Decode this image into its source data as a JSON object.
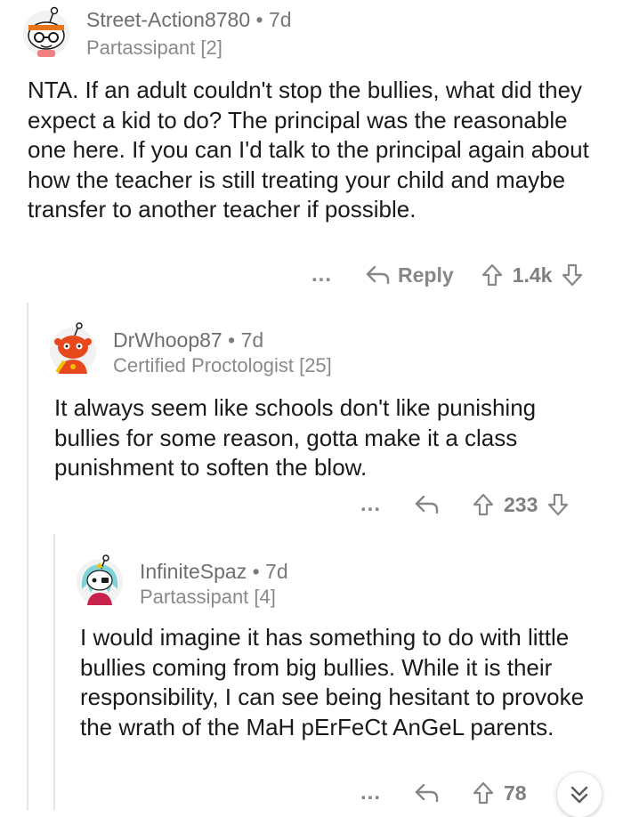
{
  "comments": [
    {
      "username": "Street-Action8780",
      "time": "7d",
      "flair": "Partassipant [2]",
      "body": "NTA. If an adult couldn't stop the bullies, what did they expect a kid to do? The principal was the reasonable one here. If you can I'd talk to the principal again about how the teacher is still treating your child and maybe transfer to another teacher if possible.",
      "more": "...",
      "reply_label": "Reply",
      "score": "1.4k",
      "avatar_icon": "snoo-avatar-headband-icon"
    },
    {
      "username": "DrWhoop87",
      "time": "7d",
      "flair": "Certified Proctologist [25]",
      "body": "It always seem like schools don't like punishing bullies for some reason, gotta make it a class punishment to soften the blow.",
      "more": "...",
      "score": "233",
      "avatar_icon": "snoo-avatar-red-icon"
    },
    {
      "username": "InfiniteSpaz",
      "time": "7d",
      "flair": "Partassipant [4]",
      "body": "I would imagine it has something to do with little bullies coming from big bullies. While it is their responsibility, I can see being hesitant to provoke the wrath of the MaH pErFeCt AnGeL parents.",
      "more": "...",
      "score": "78",
      "avatar_icon": "snoo-avatar-teal-hair-icon"
    }
  ],
  "separator": "•",
  "colors": {
    "meta_text": "#7a7a7a",
    "body_text": "#1a1a1a",
    "action_gray": "#878787",
    "thread_line": "#e5e5e5"
  }
}
